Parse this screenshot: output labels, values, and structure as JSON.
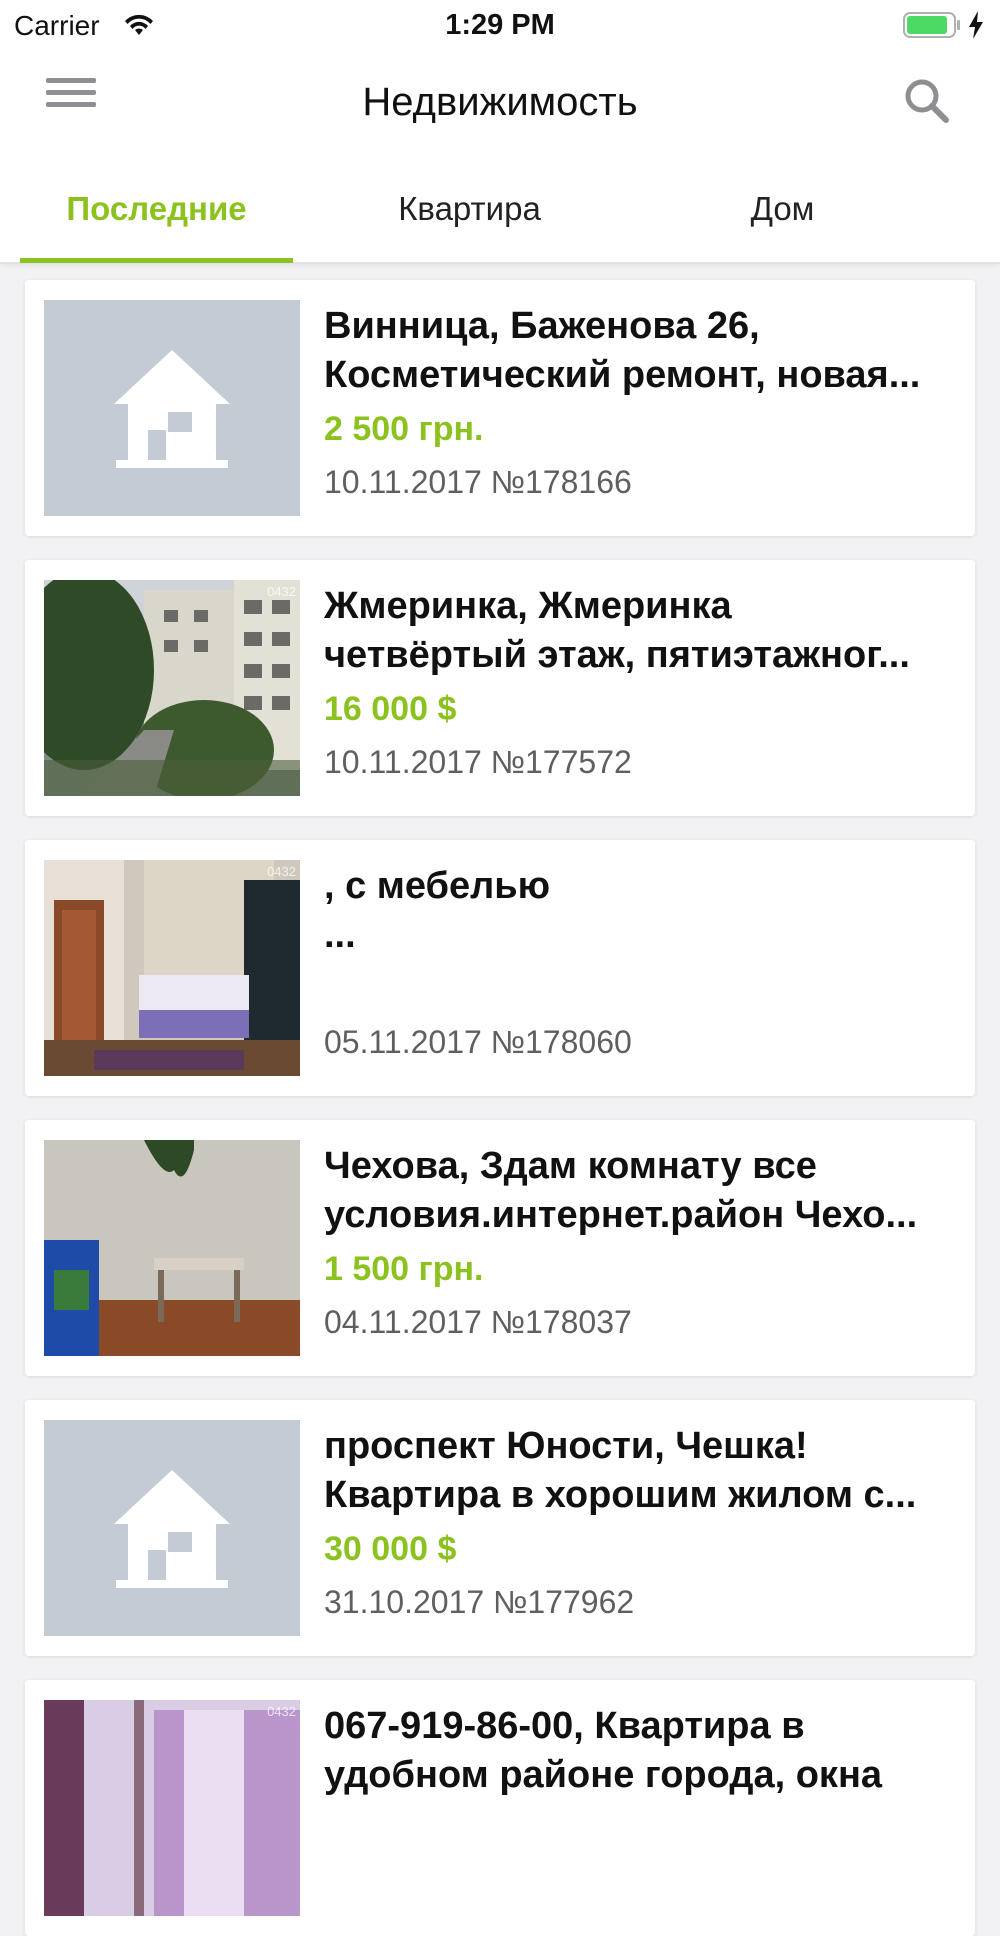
{
  "status_bar": {
    "carrier": "Carrier",
    "time": "1:29 PM",
    "battery_color": "#4cd964"
  },
  "nav": {
    "title": "Недвижимость",
    "menu_icon": "hamburger-menu-icon",
    "search_icon": "search-icon"
  },
  "tabs": [
    {
      "label": "Последние",
      "active": true
    },
    {
      "label": "Квартира",
      "active": false
    },
    {
      "label": "Дом",
      "active": false
    }
  ],
  "colors": {
    "accent": "#8cc21f",
    "placeholder_bg": "#c3ccd4",
    "meta_text": "#5f5f5f"
  },
  "listings": [
    {
      "title_line1": "Винница, Баженова 26,",
      "title_line2": "Косметический ремонт, новая...",
      "price": "2 500 грн.",
      "meta": "10.11.2017 №178166",
      "image": "placeholder-house-icon"
    },
    {
      "title_line1": "Жмеринка, Жмеринка",
      "title_line2": "четвёртый этаж, пятиэтажног...",
      "price": "16 000 $",
      "meta": "10.11.2017 №177572",
      "image": "photo-apartment-building",
      "watermark": "0432"
    },
    {
      "title_line1": ", с мебелью",
      "title_line2": "...",
      "price": "",
      "meta": "05.11.2017 №178060",
      "image": "photo-bedroom",
      "watermark": "0432"
    },
    {
      "title_line1": "Чехова, Здам комнату все",
      "title_line2": "условия.интернет.район Чехо...",
      "price": "1 500 грн.",
      "meta": "04.11.2017 №178037",
      "image": "photo-room-table"
    },
    {
      "title_line1": "проспект Юности, Чешка!",
      "title_line2": "Квартира в хорошим жилом с...",
      "price": "30 000 $",
      "meta": "31.10.2017 №177962",
      "image": "placeholder-house-icon"
    },
    {
      "title_line1": "067-919-86-00, Квартира в",
      "title_line2": "удобном районе города, окна",
      "price": "",
      "meta": "",
      "image": "photo-room-curtains",
      "watermark": "0432"
    }
  ]
}
